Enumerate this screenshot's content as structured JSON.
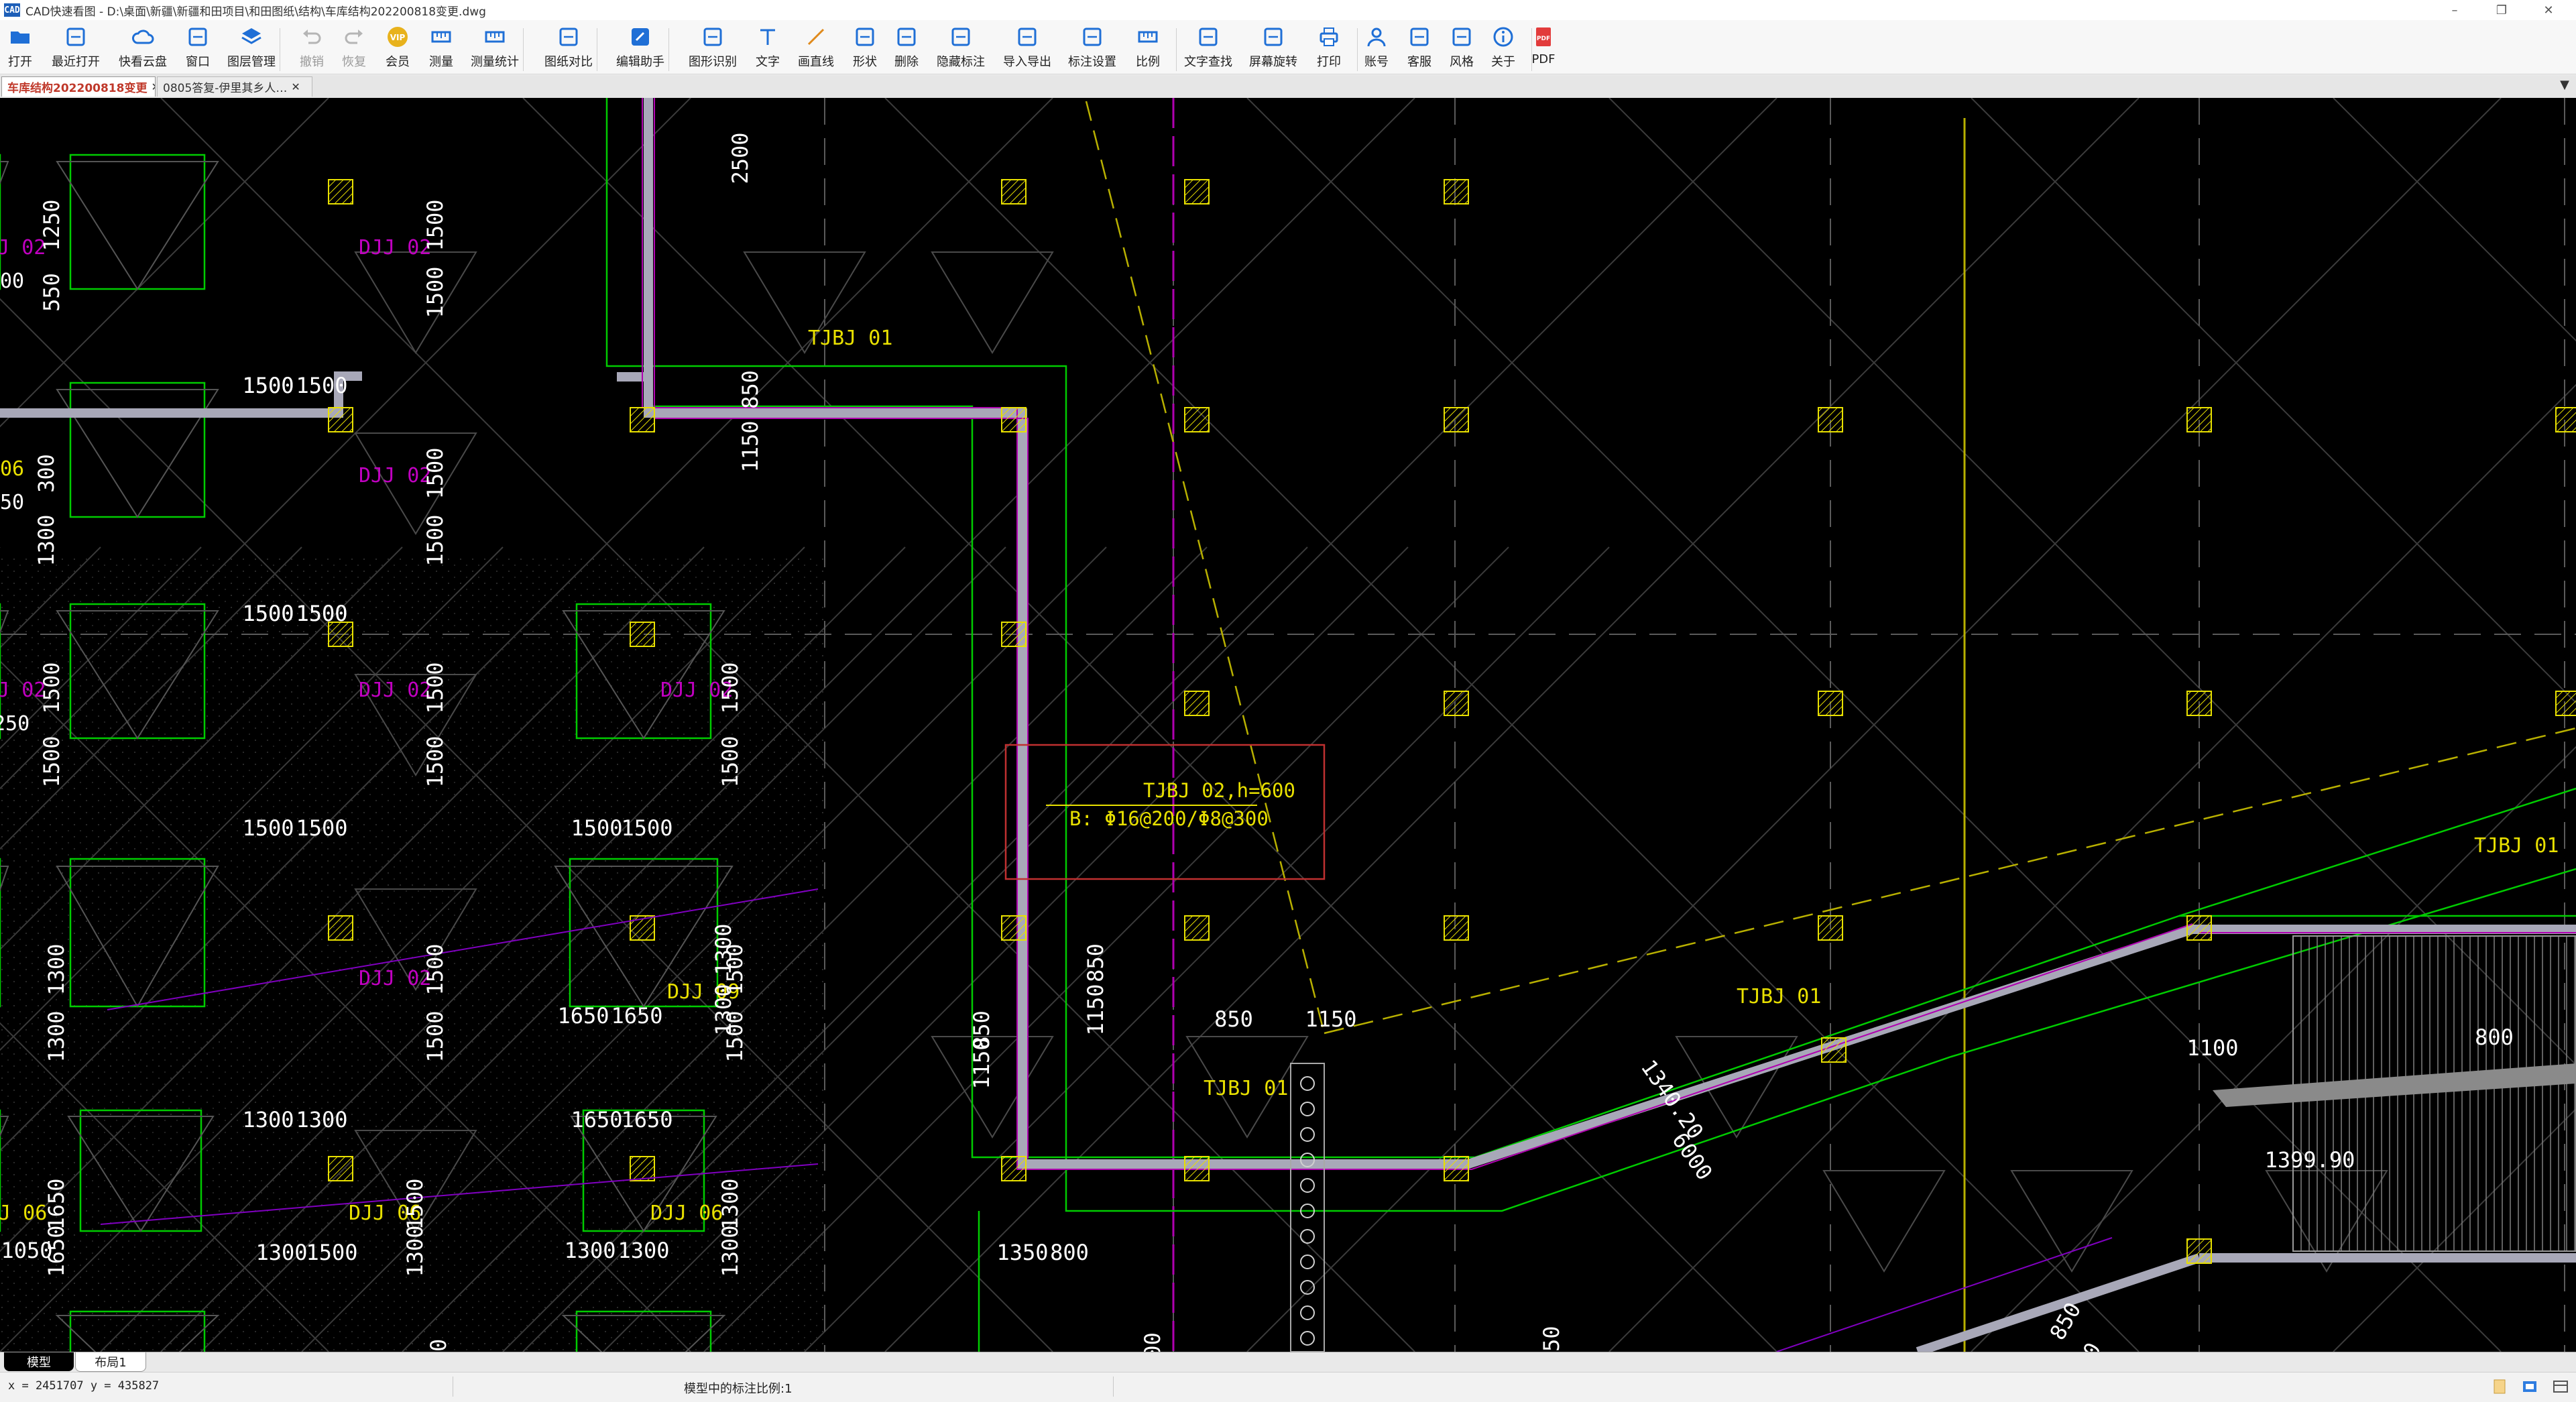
{
  "window": {
    "title": "CAD快速看图 - D:\\桌面\\新疆\\新疆和田项目\\和田图纸\\结构\\车库结构202200818变更.dwg",
    "logo_text": "CAD",
    "minimize": "–",
    "restore": "❐",
    "close": "✕"
  },
  "toolbar": {
    "items": [
      {
        "label": "打开",
        "icon": "open-folder-icon",
        "enabled": true
      },
      {
        "label": "最近打开",
        "icon": "recent-clock-icon",
        "enabled": true
      },
      {
        "label": "快看云盘",
        "icon": "cloud-icon",
        "enabled": true
      },
      {
        "label": "窗口",
        "icon": "window-icon",
        "enabled": true
      },
      {
        "label": "图层管理",
        "icon": "layers-icon",
        "enabled": true
      },
      {
        "label": "撤销",
        "icon": "undo-icon",
        "enabled": false
      },
      {
        "label": "恢复",
        "icon": "redo-icon",
        "enabled": false
      },
      {
        "label": "会员",
        "icon": "vip-icon",
        "enabled": true,
        "badge": "VIP"
      },
      {
        "label": "测量",
        "icon": "measure-icon",
        "enabled": true
      },
      {
        "label": "测量统计",
        "icon": "measure-stats-icon",
        "enabled": true
      },
      {
        "label": "图纸对比",
        "icon": "compare-icon",
        "enabled": true
      },
      {
        "label": "编辑助手",
        "icon": "edit-assistant-icon",
        "enabled": true
      },
      {
        "label": "图形识别",
        "icon": "shape-recognize-icon",
        "enabled": true
      },
      {
        "label": "文字",
        "icon": "text-icon",
        "enabled": true
      },
      {
        "label": "画直线",
        "icon": "line-icon",
        "enabled": true
      },
      {
        "label": "形状",
        "icon": "shape-icon",
        "enabled": true
      },
      {
        "label": "删除",
        "icon": "eraser-icon",
        "enabled": true
      },
      {
        "label": "隐藏标注",
        "icon": "hide-annotation-icon",
        "enabled": true
      },
      {
        "label": "导入导出",
        "icon": "import-export-icon",
        "enabled": true
      },
      {
        "label": "标注设置",
        "icon": "annotation-settings-icon",
        "enabled": true
      },
      {
        "label": "比例",
        "icon": "scale-icon",
        "enabled": true
      },
      {
        "label": "文字查找",
        "icon": "text-search-icon",
        "enabled": true
      },
      {
        "label": "屏幕旋转",
        "icon": "screen-rotate-icon",
        "enabled": true
      },
      {
        "label": "打印",
        "icon": "print-icon",
        "enabled": true
      },
      {
        "label": "账号",
        "icon": "account-icon",
        "enabled": true
      },
      {
        "label": "客服",
        "icon": "headset-icon",
        "enabled": true
      },
      {
        "label": "风格",
        "icon": "style-icon",
        "enabled": true
      },
      {
        "label": "关于",
        "icon": "info-icon",
        "enabled": true
      },
      {
        "label": "PDF",
        "icon": "pdf-icon",
        "enabled": true
      }
    ]
  },
  "tabs": [
    {
      "label": "车库结构202200818变更",
      "active": true,
      "close": "✕"
    },
    {
      "label": "0805答复-伊里其乡人…",
      "active": false,
      "close": "✕"
    }
  ],
  "tab_menu_arrow": "▼",
  "drawing": {
    "dimension_labels": [
      "1500",
      "1500",
      "1500",
      "1500",
      "1300",
      "1300",
      "1500",
      "1500",
      "1650",
      "1650",
      "1300",
      "1300",
      "1050",
      "2500",
      "850",
      "1150",
      "850",
      "1150",
      "850",
      "1150",
      "850",
      "1150",
      "1350",
      "800",
      "1100",
      "800",
      "1399.90",
      "1340.20",
      "6000",
      "850",
      "150",
      "1250",
      "550",
      "1500",
      "1500",
      "1500",
      "1500",
      "1650",
      "1650",
      "1300",
      "1300",
      "1500",
      "1500",
      "1500",
      "1500",
      "1500",
      "1500",
      "1500",
      "1500",
      "1500",
      "1300",
      "1300",
      "1300",
      "1300",
      "1500",
      "1500",
      "1500",
      "1500",
      "300",
      "1300",
      "1500",
      "1500",
      "1500",
      "1500",
      "1650",
      "1650",
      "1300",
      "1300",
      "50",
      "1650",
      "300"
    ],
    "texts": {
      "tjbj01_a": "TJBJ 01",
      "tjbj01_b": "TJBJ 01",
      "tjbj01_c": "TJBJ 01",
      "tjbj01_d": "TJBJ 01",
      "tjbj02_line1": "TJBJ 02,h=600",
      "tjbj02_line2": "B: Φ16@200/Φ8@300",
      "djj02_a": "DJJ 02",
      "djj02_b": "DJJ 02",
      "djj02_c": "DJJ 02",
      "djj02_d": "DJJ 02",
      "djj02_e": "DJJ 02",
      "djj02_f": "DJJ 02",
      "djj02_g": "DJJ 02",
      "djj09": "DJJ 09",
      "djj06_a": "DJJ 06",
      "djj06_b": "DJJ 06",
      "djj06_c": "DJ 06",
      "edge_06": "06",
      "edge_50": "50",
      "edge_250": "250",
      "edge_00": "00"
    },
    "colors": {
      "background": "#000000",
      "dimension": "#ffffff",
      "footing": "#00ff00",
      "column": "#ffff00",
      "beam": "#a8a8b8",
      "label_magenta": "#c000c0",
      "label_yellow": "#e8e000",
      "highlight_box": "#c03030",
      "hatch": "#3a3a3a"
    }
  },
  "layout_tabs": [
    "模型",
    "布局1"
  ],
  "status": {
    "coordinates": "x = 2451707  y = 435827",
    "scale_text": "模型中的标注比例:1"
  }
}
